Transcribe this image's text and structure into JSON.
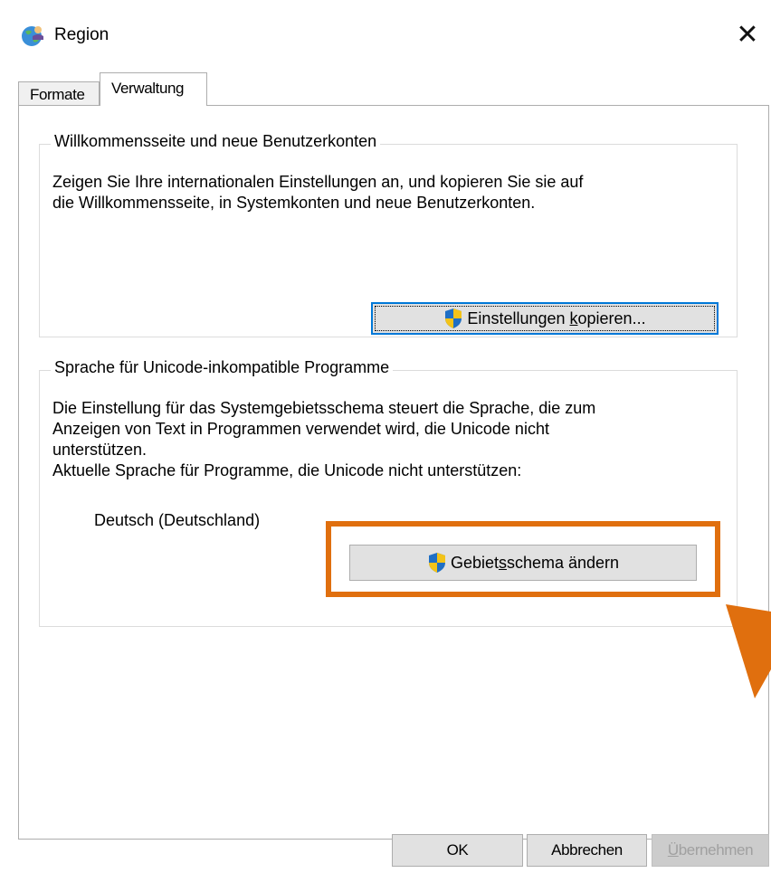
{
  "window": {
    "title": "Region",
    "close_glyph": "✕",
    "app_icon": "globe-with-person-icon"
  },
  "tabs": [
    {
      "label": "Formate",
      "active": false
    },
    {
      "label": "Verwaltung",
      "active": true
    }
  ],
  "welcome_group": {
    "legend": "Willkommensseite und neue Benutzerkonten",
    "line1": "Zeigen Sie Ihre internationalen Einstellungen an, und kopieren Sie sie auf",
    "line2": "die Willkommensseite, in Systemkonten und neue Benutzerkonten.",
    "button_prefix": "Einstellungen ",
    "button_underlined": "k",
    "button_suffix": "opieren..."
  },
  "unicode_group": {
    "legend": "Sprache für Unicode-inkompatible Programme",
    "line1": "Die Einstellung für das Systemgebietsschema steuert die Sprache, die zum",
    "line2": "Anzeigen von Text in Programmen verwendet wird, die Unicode nicht",
    "line3": "unterstützen.",
    "current_label": "Aktuelle Sprache für Programme, die Unicode nicht unterstützen:",
    "current_value": "Deutsch (Deutschland)",
    "button_prefix": "Gebiet",
    "button_underlined": "s",
    "button_suffix": "schema ändern"
  },
  "dialog_buttons": {
    "ok": "OK",
    "cancel": "Abbrechen",
    "apply_underlined": "Ü",
    "apply_rest": "bernehmen"
  },
  "colors": {
    "highlight": "#e06f0e",
    "focus_border": "#0078d7",
    "button_face": "#e1e1e1"
  }
}
